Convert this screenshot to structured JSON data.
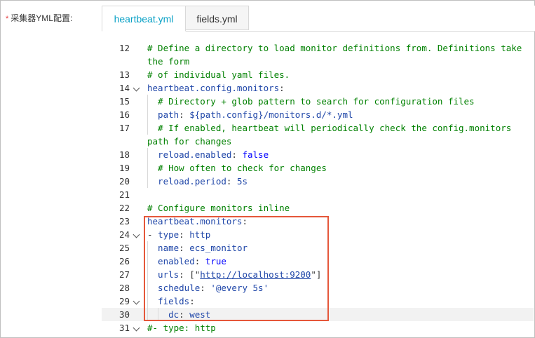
{
  "form": {
    "required_mark": "*",
    "label": "采集器YML配置:"
  },
  "tabs": [
    {
      "label": "heartbeat.yml",
      "active": true
    },
    {
      "label": "fields.yml",
      "active": false
    }
  ],
  "highlight_color": "#e5573a",
  "editor": {
    "lines": [
      {
        "num": "12",
        "fold": false,
        "indent": 0,
        "parts": [
          {
            "t": "# Define a directory to load monitor definitions from. Definitions take",
            "c": "c"
          }
        ]
      },
      {
        "num": "",
        "fold": false,
        "indent": 0,
        "parts": [
          {
            "t": "the form",
            "c": "c"
          }
        ]
      },
      {
        "num": "13",
        "fold": false,
        "indent": 0,
        "parts": [
          {
            "t": "# of individual yaml files.",
            "c": "c"
          }
        ]
      },
      {
        "num": "14",
        "fold": true,
        "indent": 0,
        "parts": [
          {
            "t": "heartbeat.config.monitors",
            "c": "k"
          },
          {
            "t": ":",
            "c": "p"
          }
        ]
      },
      {
        "num": "15",
        "fold": false,
        "indent": 1,
        "parts": [
          {
            "t": "# Directory + glob pattern to search for configuration files",
            "c": "c"
          }
        ]
      },
      {
        "num": "16",
        "fold": false,
        "indent": 1,
        "parts": [
          {
            "t": "path",
            "c": "k"
          },
          {
            "t": ": ",
            "c": "p"
          },
          {
            "t": "${path.config}/monitors.d/*.yml",
            "c": "k"
          }
        ]
      },
      {
        "num": "17",
        "fold": false,
        "indent": 1,
        "parts": [
          {
            "t": "# If enabled, heartbeat will periodically check the config.monitors",
            "c": "c"
          }
        ]
      },
      {
        "num": "",
        "fold": false,
        "indent": 0,
        "parts": [
          {
            "t": "path for changes",
            "c": "c"
          }
        ]
      },
      {
        "num": "18",
        "fold": false,
        "indent": 1,
        "parts": [
          {
            "t": "reload.enabled",
            "c": "k"
          },
          {
            "t": ": ",
            "c": "p"
          },
          {
            "t": "false",
            "c": "v"
          }
        ]
      },
      {
        "num": "19",
        "fold": false,
        "indent": 1,
        "parts": [
          {
            "t": "# How often to check for changes",
            "c": "c"
          }
        ]
      },
      {
        "num": "20",
        "fold": false,
        "indent": 1,
        "parts": [
          {
            "t": "reload.period",
            "c": "k"
          },
          {
            "t": ": ",
            "c": "p"
          },
          {
            "t": "5s",
            "c": "k"
          }
        ]
      },
      {
        "num": "21",
        "fold": false,
        "indent": 0,
        "parts": []
      },
      {
        "num": "22",
        "fold": false,
        "indent": 0,
        "parts": [
          {
            "t": "# Configure monitors inline",
            "c": "c"
          }
        ]
      },
      {
        "num": "23",
        "fold": false,
        "indent": 0,
        "parts": [
          {
            "t": "heartbeat.monitors",
            "c": "k"
          },
          {
            "t": ":",
            "c": "p"
          }
        ]
      },
      {
        "num": "24",
        "fold": true,
        "indent": 0,
        "parts": [
          {
            "t": "- ",
            "c": "p"
          },
          {
            "t": "type",
            "c": "k"
          },
          {
            "t": ": ",
            "c": "p"
          },
          {
            "t": "http",
            "c": "k"
          }
        ]
      },
      {
        "num": "25",
        "fold": false,
        "indent": 1,
        "parts": [
          {
            "t": "name",
            "c": "k"
          },
          {
            "t": ": ",
            "c": "p"
          },
          {
            "t": "ecs_monitor",
            "c": "k"
          }
        ]
      },
      {
        "num": "26",
        "fold": false,
        "indent": 1,
        "parts": [
          {
            "t": "enabled",
            "c": "k"
          },
          {
            "t": ": ",
            "c": "p"
          },
          {
            "t": "true",
            "c": "v"
          }
        ]
      },
      {
        "num": "27",
        "fold": false,
        "indent": 1,
        "parts": [
          {
            "t": "urls",
            "c": "k"
          },
          {
            "t": ": [\"",
            "c": "p"
          },
          {
            "t": "http://localhost:9200",
            "c": "u"
          },
          {
            "t": "\"]",
            "c": "p"
          }
        ]
      },
      {
        "num": "28",
        "fold": false,
        "indent": 1,
        "parts": [
          {
            "t": "schedule",
            "c": "k"
          },
          {
            "t": ": ",
            "c": "p"
          },
          {
            "t": "'@every 5s'",
            "c": "k"
          }
        ]
      },
      {
        "num": "29",
        "fold": true,
        "indent": 1,
        "parts": [
          {
            "t": "fields",
            "c": "k"
          },
          {
            "t": ":",
            "c": "p"
          }
        ]
      },
      {
        "num": "30",
        "fold": false,
        "indent": 2,
        "current": true,
        "parts": [
          {
            "t": "dc",
            "c": "k"
          },
          {
            "t": ": ",
            "c": "p"
          },
          {
            "t": "west",
            "c": "k"
          }
        ]
      },
      {
        "num": "31",
        "fold": true,
        "indent": 0,
        "parts": [
          {
            "t": "#- type: http",
            "c": "c"
          }
        ]
      }
    ]
  }
}
